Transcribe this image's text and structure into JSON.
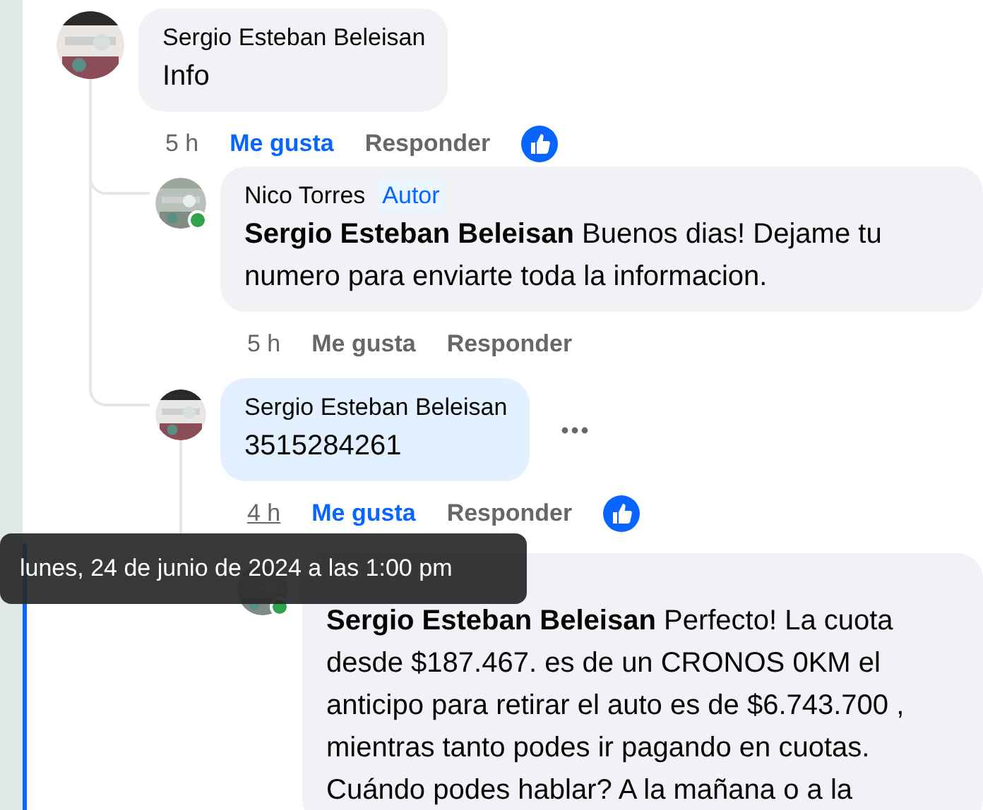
{
  "comments": [
    {
      "author": "Sergio Esteban Beleisan",
      "text": "Info",
      "time": "5 h",
      "like_label": "Me gusta",
      "reply_label": "Responder",
      "liked": true,
      "online": false,
      "highlighted": false,
      "time_hovered": false,
      "menu_shown": false,
      "children": [
        {
          "author": "Nico Torres",
          "badge": "Autor",
          "text": "**Sergio Esteban Beleisan** Buenos dias! Dejame tu numero para enviarte toda la informacion.",
          "time": "5 h",
          "like_label": "Me gusta",
          "reply_label": "Responder",
          "liked": false,
          "online": true,
          "highlighted": false,
          "time_hovered": false,
          "menu_shown": false
        },
        {
          "author": "Sergio Esteban Beleisan",
          "text": "3515284261",
          "time": "4 h",
          "like_label": "Me gusta",
          "reply_label": "Responder",
          "liked": true,
          "online": false,
          "highlighted": true,
          "time_hovered": true,
          "menu_shown": true,
          "children": [
            {
              "text": "**Sergio Esteban Beleisan** Perfecto! La cuota desde $187.467. es de un CRONOS 0KM el anticipo para retirar el auto es de $6.743.700 , mientras tanto podes ir pagando en cuotas. Cuándo podes hablar? A la mañana o a la",
              "online": true,
              "highlighted": false
            }
          ]
        }
      ]
    }
  ],
  "tooltip": {
    "text": "lunes, 24 de junio de 2024 a las 1:00 pm"
  }
}
